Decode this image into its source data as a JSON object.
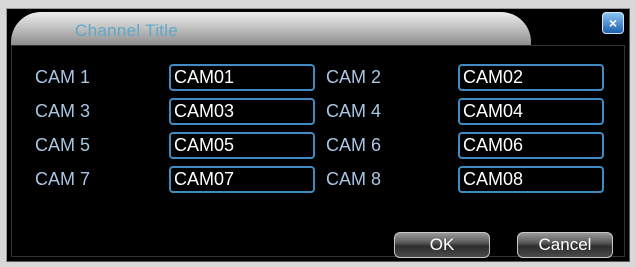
{
  "dialog": {
    "title": "Channel Title",
    "close_label": "×"
  },
  "channels": [
    {
      "label": "CAM 1",
      "value": "CAM01"
    },
    {
      "label": "CAM 2",
      "value": "CAM02"
    },
    {
      "label": "CAM 3",
      "value": "CAM03"
    },
    {
      "label": "CAM 4",
      "value": "CAM04"
    },
    {
      "label": "CAM 5",
      "value": "CAM05"
    },
    {
      "label": "CAM 6",
      "value": "CAM06"
    },
    {
      "label": "CAM 7",
      "value": "CAM07"
    },
    {
      "label": "CAM 8",
      "value": "CAM08"
    }
  ],
  "buttons": {
    "ok_label": "OK",
    "cancel_label": "Cancel"
  },
  "colors": {
    "label_text": "#a8c6e4",
    "field_border": "#3e8cc2",
    "title_text": "#5fa8c9",
    "background": "#000000"
  }
}
